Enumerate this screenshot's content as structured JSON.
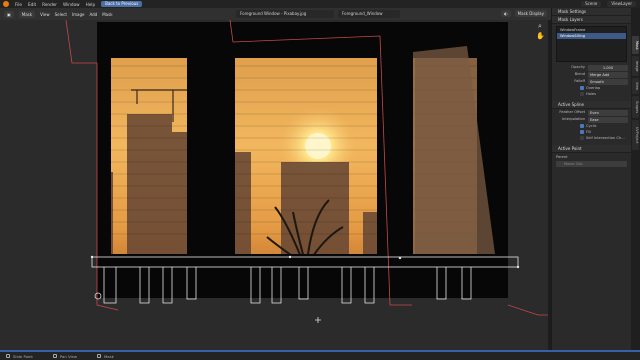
{
  "topbar": {
    "menus": [
      "File",
      "Edit",
      "Render",
      "Window",
      "Help"
    ],
    "back_button": "Back to Previous",
    "scene": "Scene",
    "view_layer": "ViewLayer"
  },
  "header": {
    "mode": "Mask",
    "menus": [
      "View",
      "Select",
      "Image",
      "Add",
      "Mask"
    ],
    "image_name": "Foreground Window - Pixabay.jpg",
    "mask_name": "Foreground_Window",
    "display_button": "Mask Display"
  },
  "panel": {
    "mask_settings": "Mask Settings",
    "mask_layers": "Mask Layers",
    "layers": [
      "WindowFrame",
      "WindowSilling"
    ],
    "selected_layer": 1,
    "opacity_label": "Opacity",
    "opacity_value": "1.000",
    "blend_label": "Blend",
    "blend_value": "Merge Add",
    "falloff_label": "Falloff",
    "falloff_value": "Smooth",
    "overlap": "Overlap",
    "holes": "Holes",
    "active_spline": "Active Spline",
    "feather_offset_label": "Feather Offset",
    "feather_offset_value": "Even",
    "interpolation_label": "Interpolation",
    "interpolation_value": "Ease",
    "cyclic": "Cyclic",
    "fill": "Fill",
    "self_intersection": "Self Intersection Ch...",
    "active_point": "Active Point",
    "parent_label": "Parent",
    "parent_value": "Movie Clip"
  },
  "tabs": [
    "Mask",
    "Image",
    "View",
    "Scopes",
    "UVProject"
  ],
  "status": [
    "Slide Point",
    "Pan View",
    "Mask"
  ],
  "colors": {
    "accent": "#3b5ea8",
    "selection": "#3d5a86",
    "sky_top": "#f0b25a",
    "sky_bottom": "#c9772c",
    "sun": "#fff2b0",
    "mask_line": "#c24a4a"
  }
}
